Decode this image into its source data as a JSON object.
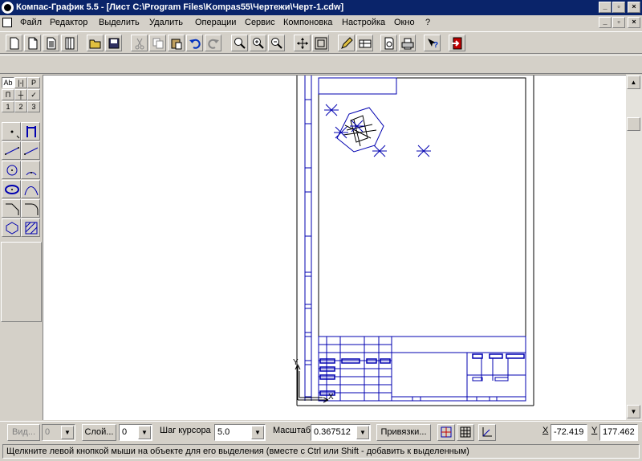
{
  "window": {
    "title": "Компас-График 5.5 - [Лист C:\\Program Files\\Kompas55\\Чертежи\\Черт-1.cdw]",
    "minimize": "_",
    "restore": "▫",
    "close": "×"
  },
  "menu": {
    "items": [
      "Файл",
      "Редактор",
      "Выделить",
      "Удалить",
      "Операции",
      "Сервис",
      "Компоновка",
      "Настройка",
      "Окно",
      "?"
    ]
  },
  "toolbar": {
    "icons": [
      "new-drawing-icon",
      "new-fragment-icon",
      "new-text-doc-icon",
      "new-spec-icon",
      "open-icon",
      "save-icon",
      "cut-icon",
      "copy-icon",
      "paste-icon",
      "undo-icon",
      "redo-icon",
      "zoom-icon",
      "zoom-in-icon",
      "zoom-out-icon",
      "pan-icon",
      "zoom-fit-icon",
      "edit-icon",
      "table-icon",
      "print-preview-icon",
      "print-icon",
      "context-help-icon",
      "exit-icon"
    ]
  },
  "leftpanel": {
    "tabs_row1": [
      "Ab",
      "|-|",
      "P"
    ],
    "tabs_row2": [
      "П",
      "┼",
      "✓"
    ],
    "tabs_row3": [
      "1",
      "2",
      "3"
    ]
  },
  "bottom": {
    "view_label": "Вид...",
    "view_value": "0",
    "layer_label": "Слой...",
    "layer_value": "0",
    "step_label": "Шаг курсора",
    "step_value": "5.0",
    "scale_label": "Масштаб",
    "scale_value": "0.367512",
    "snaps_label": "Привязки...",
    "x_label": "X",
    "x_value": "-72.419",
    "y_label": "Y",
    "y_value": "177.462"
  },
  "status": {
    "text": "Щелкните левой кнопкой мыши на объекте для его выделения (вместе с Ctrl или Shift - добавить к выделенным)"
  },
  "canvas": {
    "axis_y": "Y",
    "axis_x": "X"
  },
  "colors": {
    "titlebar": "#0a246a",
    "drawing_blue": "#0000b0",
    "frame_black": "#000000"
  }
}
